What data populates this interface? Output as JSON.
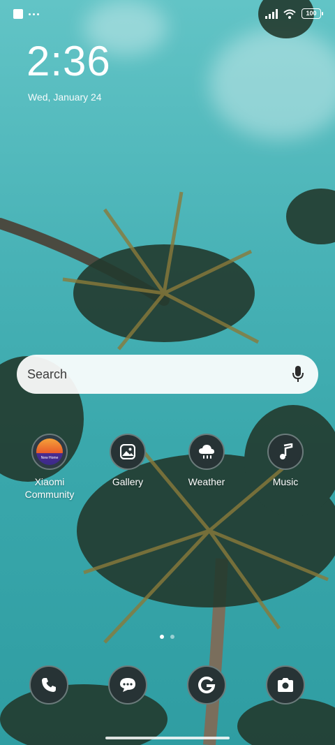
{
  "status_bar": {
    "battery": "100"
  },
  "clock": {
    "time": "2:36",
    "date": "Wed, January 24"
  },
  "search": {
    "placeholder": "Search"
  },
  "apps": [
    {
      "label": "Xiaomi\nCommunity",
      "icon": "xiaomi-community-icon"
    },
    {
      "label": "Gallery",
      "icon": "gallery-icon"
    },
    {
      "label": "Weather",
      "icon": "weather-icon"
    },
    {
      "label": "Music",
      "icon": "music-icon"
    }
  ],
  "dock": [
    {
      "icon": "phone-icon"
    },
    {
      "icon": "messages-icon"
    },
    {
      "icon": "google-icon"
    },
    {
      "icon": "camera-icon"
    }
  ],
  "page_indicator": {
    "pages": 2,
    "current": 1
  },
  "colors": {
    "sky": "#48b2b6",
    "icon_bg": "#273335",
    "icon_ring": "#6b7b7b"
  }
}
